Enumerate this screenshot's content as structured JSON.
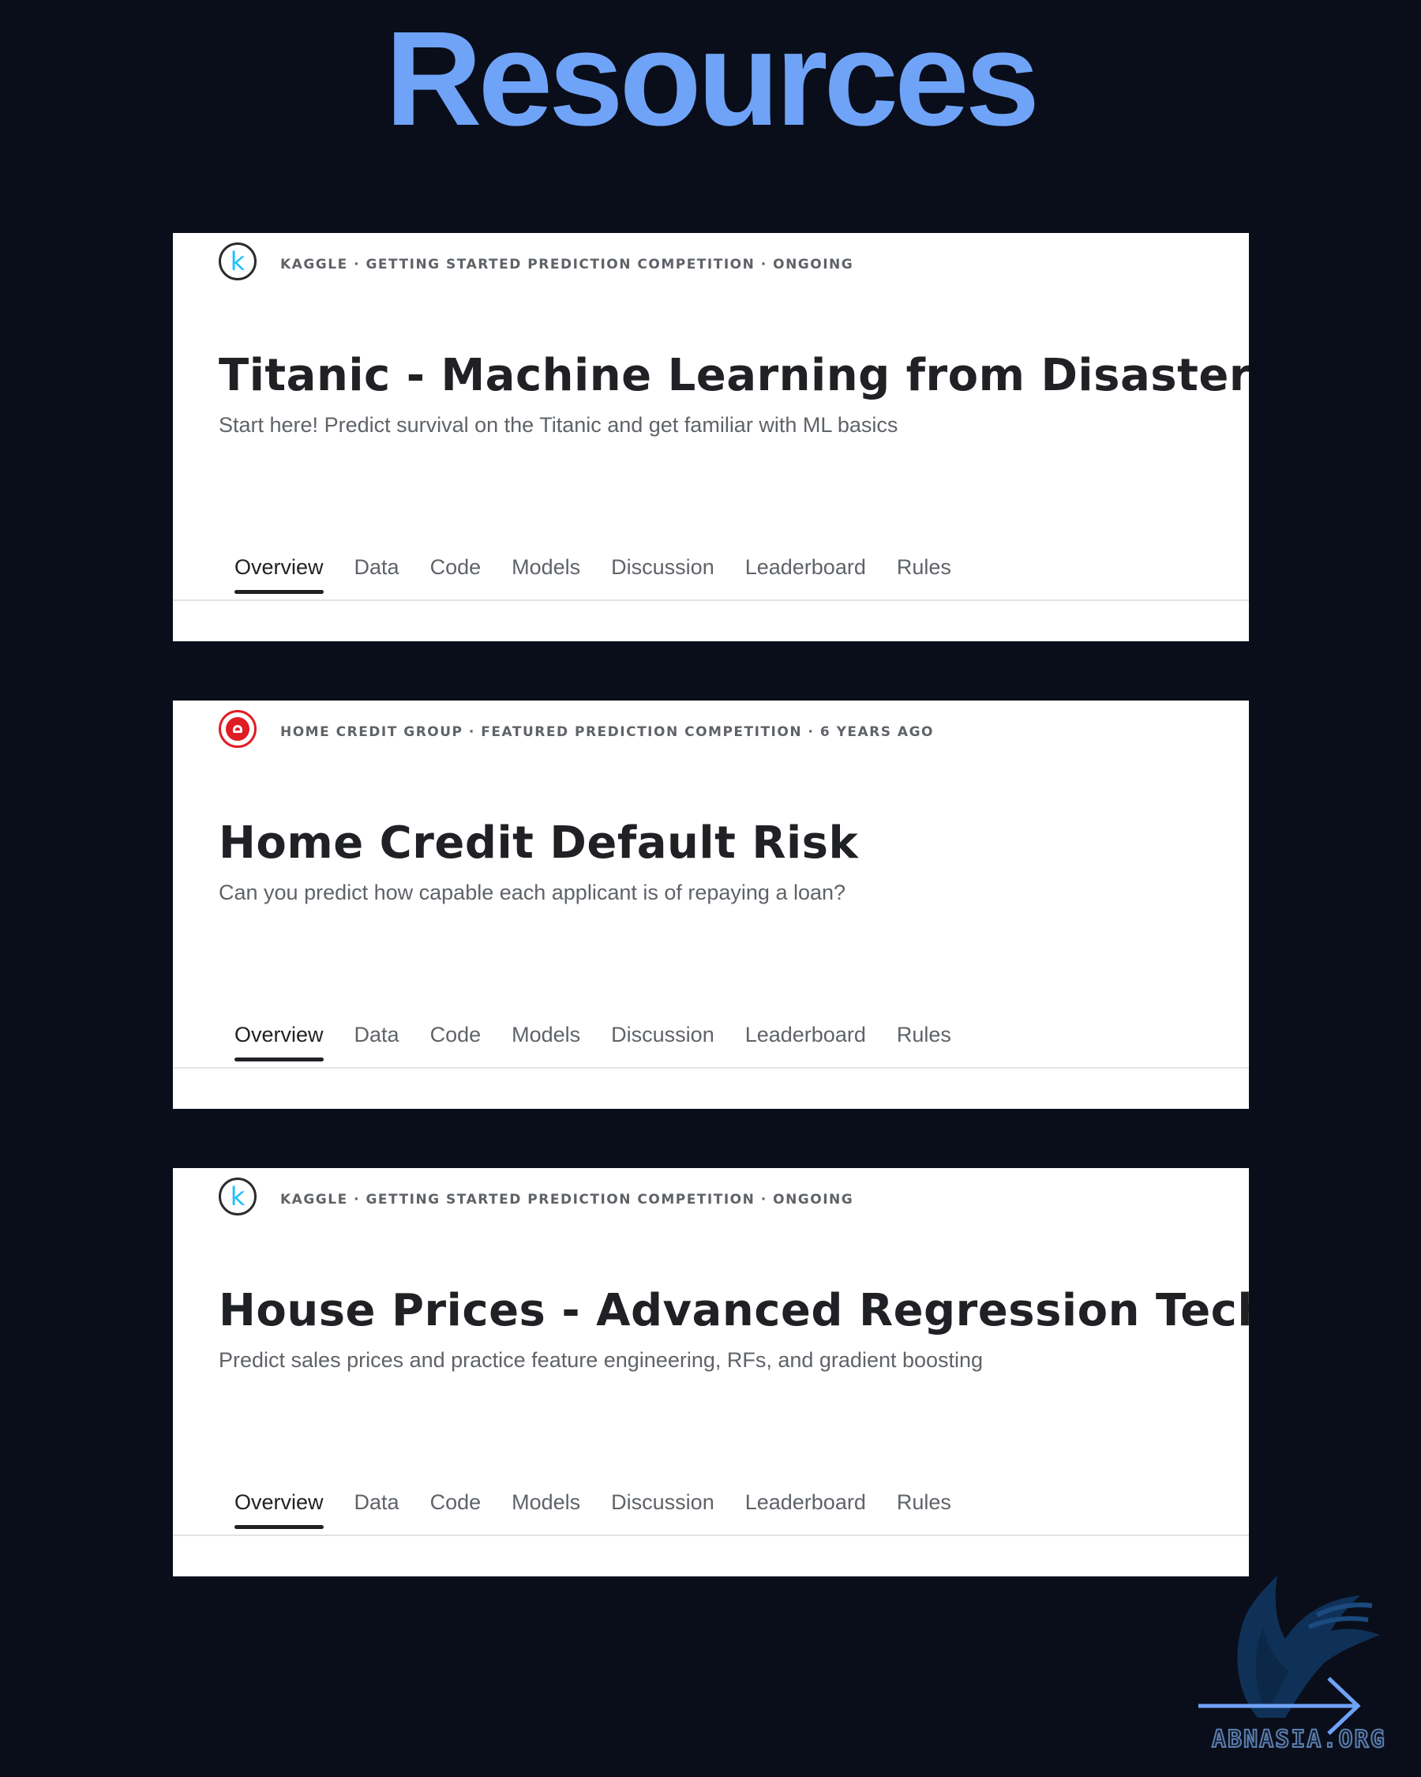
{
  "page": {
    "title": "Resources",
    "title_color": "#6fa3f7",
    "background": "#0a0e1a"
  },
  "cards": [
    {
      "logo_icon": "kaggle-k-icon",
      "logo_text": "k",
      "meta": "KAGGLE · GETTING STARTED PREDICTION COMPETITION · ONGOING",
      "title": "Titanic - Machine Learning from Disaster",
      "subtitle": "Start here! Predict survival on the Titanic and get familiar with ML basics",
      "tabs": [
        "Overview",
        "Data",
        "Code",
        "Models",
        "Discussion",
        "Leaderboard",
        "Rules"
      ],
      "active_tab": "Overview"
    },
    {
      "logo_icon": "home-credit-logo-icon",
      "meta": "HOME CREDIT GROUP · FEATURED PREDICTION COMPETITION · 6 YEARS AGO",
      "title": "Home Credit Default Risk",
      "subtitle": "Can you predict how capable each applicant is of repaying a loan?",
      "tabs": [
        "Overview",
        "Data",
        "Code",
        "Models",
        "Discussion",
        "Leaderboard",
        "Rules"
      ],
      "active_tab": "Overview"
    },
    {
      "logo_icon": "kaggle-k-icon",
      "logo_text": "k",
      "meta": "KAGGLE · GETTING STARTED PREDICTION COMPETITION · ONGOING",
      "title": "House Prices - Advanced Regression Techniq",
      "subtitle": "Predict sales prices and practice feature engineering, RFs, and gradient boosting",
      "tabs": [
        "Overview",
        "Data",
        "Code",
        "Models",
        "Discussion",
        "Leaderboard",
        "Rules"
      ],
      "active_tab": "Overview"
    }
  ],
  "watermark": {
    "text": "ABNASIA.ORG",
    "icon": "eagle-arrow-logo-icon"
  }
}
